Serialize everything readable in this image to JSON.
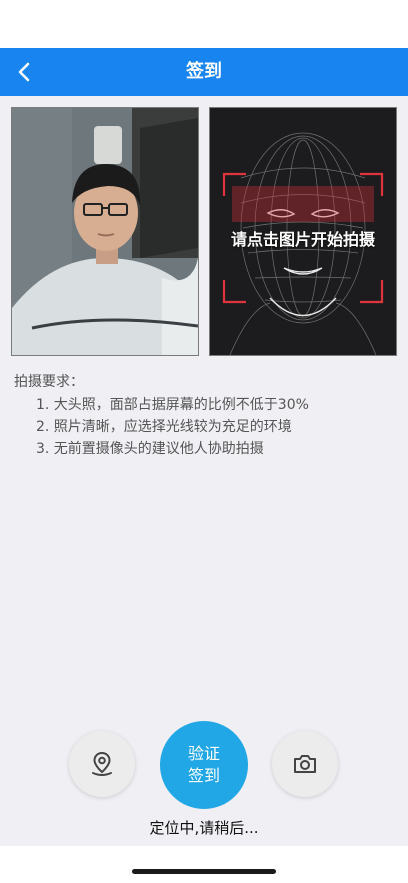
{
  "nav": {
    "title": "签到"
  },
  "face_panel": {
    "overlay_text": "请点击图片开始拍摄"
  },
  "requirements": {
    "title": "拍摄要求：",
    "items": [
      "1. 大头照，面部占据屏幕的比例不低于30%",
      "2. 照片清晰，应选择光线较为充足的环境",
      "3. 无前置摄像头的建议他人协助拍摄"
    ]
  },
  "actions": {
    "verify_line1": "验证",
    "verify_line2": "签到",
    "location_icon": "location-pin-icon",
    "camera_icon": "camera-icon"
  },
  "status": {
    "text": "定位中,请稍后..."
  },
  "colors": {
    "nav_bg": "#1784f0",
    "verify_bg": "#21a7e6",
    "page_bg": "#efeff4",
    "face_guide_red": "#e0343c"
  }
}
